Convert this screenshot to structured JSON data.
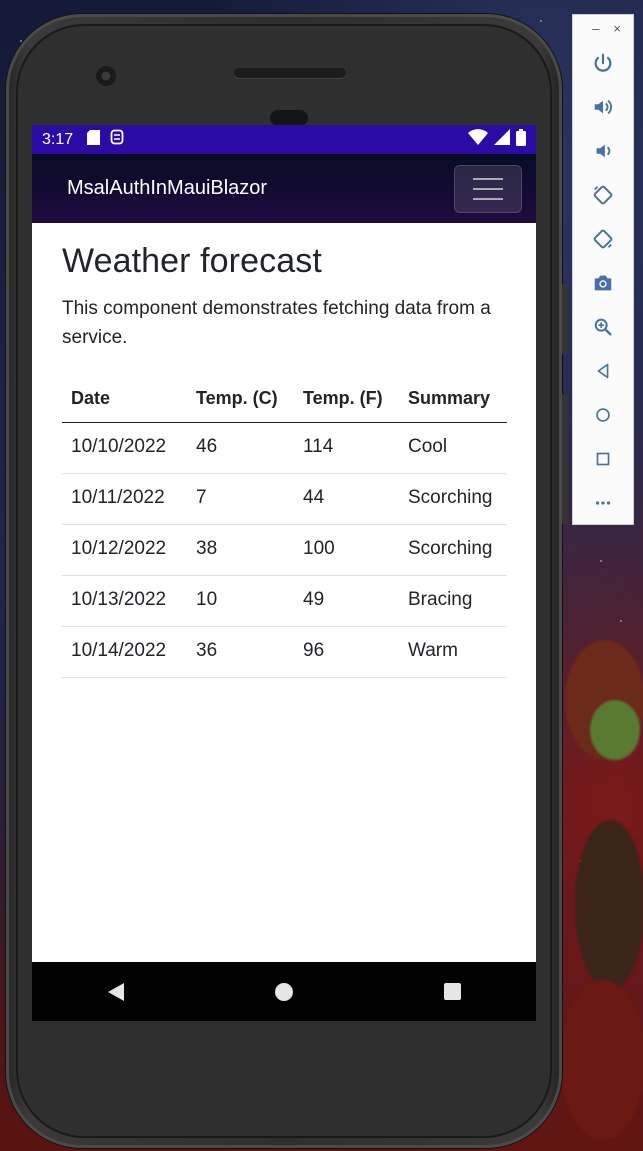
{
  "status_bar": {
    "time": "3:17"
  },
  "app": {
    "brand": "MsalAuthInMauiBlazor"
  },
  "page": {
    "title": "Weather forecast",
    "description": "This component demonstrates fetching data from a service."
  },
  "table": {
    "headers": [
      "Date",
      "Temp. (C)",
      "Temp. (F)",
      "Summary"
    ],
    "rows": [
      [
        "10/10/2022",
        "46",
        "114",
        "Cool"
      ],
      [
        "10/11/2022",
        "7",
        "44",
        "Scorching"
      ],
      [
        "10/12/2022",
        "38",
        "100",
        "Scorching"
      ],
      [
        "10/13/2022",
        "10",
        "49",
        "Bracing"
      ],
      [
        "10/14/2022",
        "36",
        "96",
        "Warm"
      ]
    ]
  },
  "emulator": {
    "minimize": "–",
    "close": "×",
    "tools": [
      "power-icon",
      "volume-up-icon",
      "volume-down-icon",
      "rotate-left-icon",
      "rotate-right-icon",
      "camera-icon",
      "zoom-icon",
      "back-icon",
      "home-icon",
      "overview-icon",
      "more-icon"
    ]
  },
  "colors": {
    "status_bar": "#2b0aa6",
    "navbar_top": "#070c25",
    "navbar_bottom": "#20093f",
    "emulator_icon": "#4a6fa5"
  }
}
